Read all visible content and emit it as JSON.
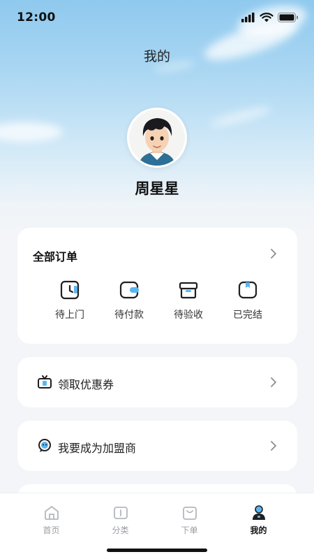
{
  "status_bar": {
    "time": "12:00"
  },
  "header": {
    "title": "我的"
  },
  "profile": {
    "name": "周星星"
  },
  "orders": {
    "title": "全部订单",
    "items": [
      {
        "label": "待上门",
        "icon": "clock-icon"
      },
      {
        "label": "待付款",
        "icon": "wallet-icon"
      },
      {
        "label": "待验收",
        "icon": "box-icon"
      },
      {
        "label": "已完结",
        "icon": "package-check-icon"
      }
    ]
  },
  "menu": [
    {
      "label": "领取优惠券",
      "icon": "coupon-icon"
    },
    {
      "label": "我要成为加盟商",
      "icon": "chat-bot-icon"
    }
  ],
  "tabbar": {
    "items": [
      {
        "label": "首页",
        "icon": "home-icon",
        "active": false
      },
      {
        "label": "分类",
        "icon": "book-icon",
        "active": false
      },
      {
        "label": "下单",
        "icon": "bag-icon",
        "active": false
      },
      {
        "label": "我的",
        "icon": "user-icon",
        "active": true
      }
    ]
  },
  "colors": {
    "accent": "#5bb6f0",
    "sky": "#a9d6f2"
  }
}
